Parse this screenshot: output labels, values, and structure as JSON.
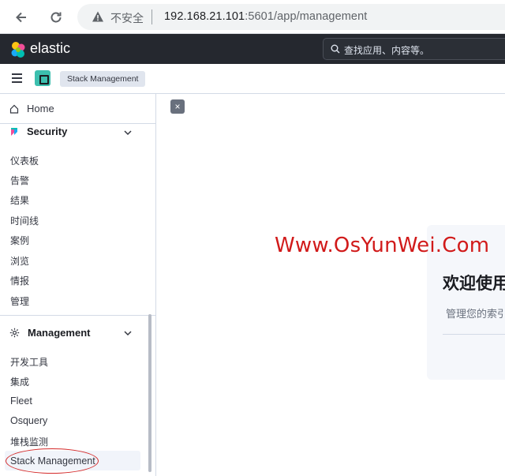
{
  "browser": {
    "back_icon": "arrow-left-icon",
    "reload_icon": "reload-icon",
    "security_warning": "不安全",
    "url_host": "192.168.21.101",
    "url_rest": ":5601/app/management"
  },
  "header": {
    "brand": "elastic",
    "search_placeholder": "查找应用、内容等。"
  },
  "breadcrumb": {
    "current": "Stack Management"
  },
  "sidenav": {
    "home": "Home",
    "security": {
      "title": "Security",
      "items": [
        "仪表板",
        "告警",
        "结果",
        "时间线",
        "案例",
        "浏览",
        "情报",
        "管理"
      ]
    },
    "management": {
      "title": "Management",
      "items": [
        "开发工具",
        "集成",
        "Fleet",
        "Osquery",
        "堆栈监测",
        "Stack Management"
      ]
    }
  },
  "main": {
    "close_label": "×",
    "watermark": "Www.OsYunWei.Com",
    "welcome_title": "欢迎使用",
    "welcome_desc": "管理您的索引"
  },
  "colors": {
    "header_bg": "#25282f",
    "annotation_circle": "#d42a2a",
    "watermark": "#d11a1a",
    "app_badge": "#3cbfae"
  }
}
